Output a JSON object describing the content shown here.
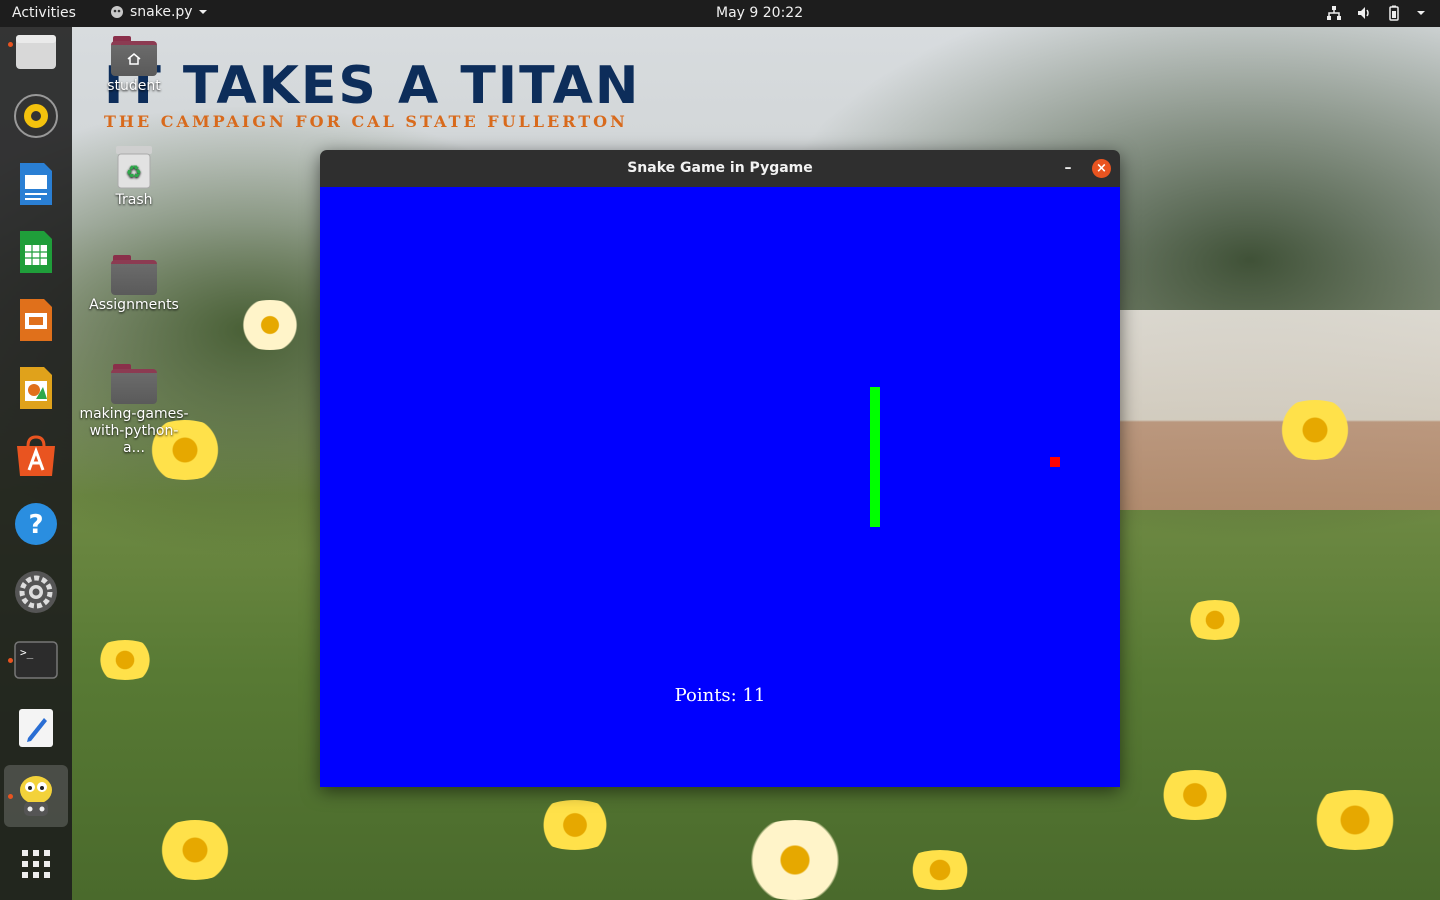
{
  "topbar": {
    "activities": "Activities",
    "app_name": "snake.py",
    "clock": "May 9  20:22"
  },
  "wallpaper": {
    "title": "IT TAKES A TITAN",
    "subtitle": "THE CAMPAIGN FOR CAL STATE FULLERTON"
  },
  "desktop": {
    "icons": [
      {
        "label": "student"
      },
      {
        "label": "Trash"
      },
      {
        "label": "Assignments"
      },
      {
        "label": "making-games-",
        "label2": "with-python-a..."
      }
    ]
  },
  "dock": {
    "items": [
      "files-icon",
      "rhythmbox-icon",
      "writer-icon",
      "calc-icon",
      "impress-icon",
      "draw-icon",
      "software-icon",
      "help-icon",
      "settings-icon",
      "terminal-icon",
      "text-editor-icon",
      "pygame-icon",
      "show-apps-icon"
    ]
  },
  "window": {
    "title": "Snake Game in Pygame",
    "min_label": "–",
    "close_label": "×"
  },
  "game": {
    "points_text": "Points: 11",
    "background": "#0000ff",
    "snake_color": "#00ff00",
    "food_color": "#ff0000"
  }
}
